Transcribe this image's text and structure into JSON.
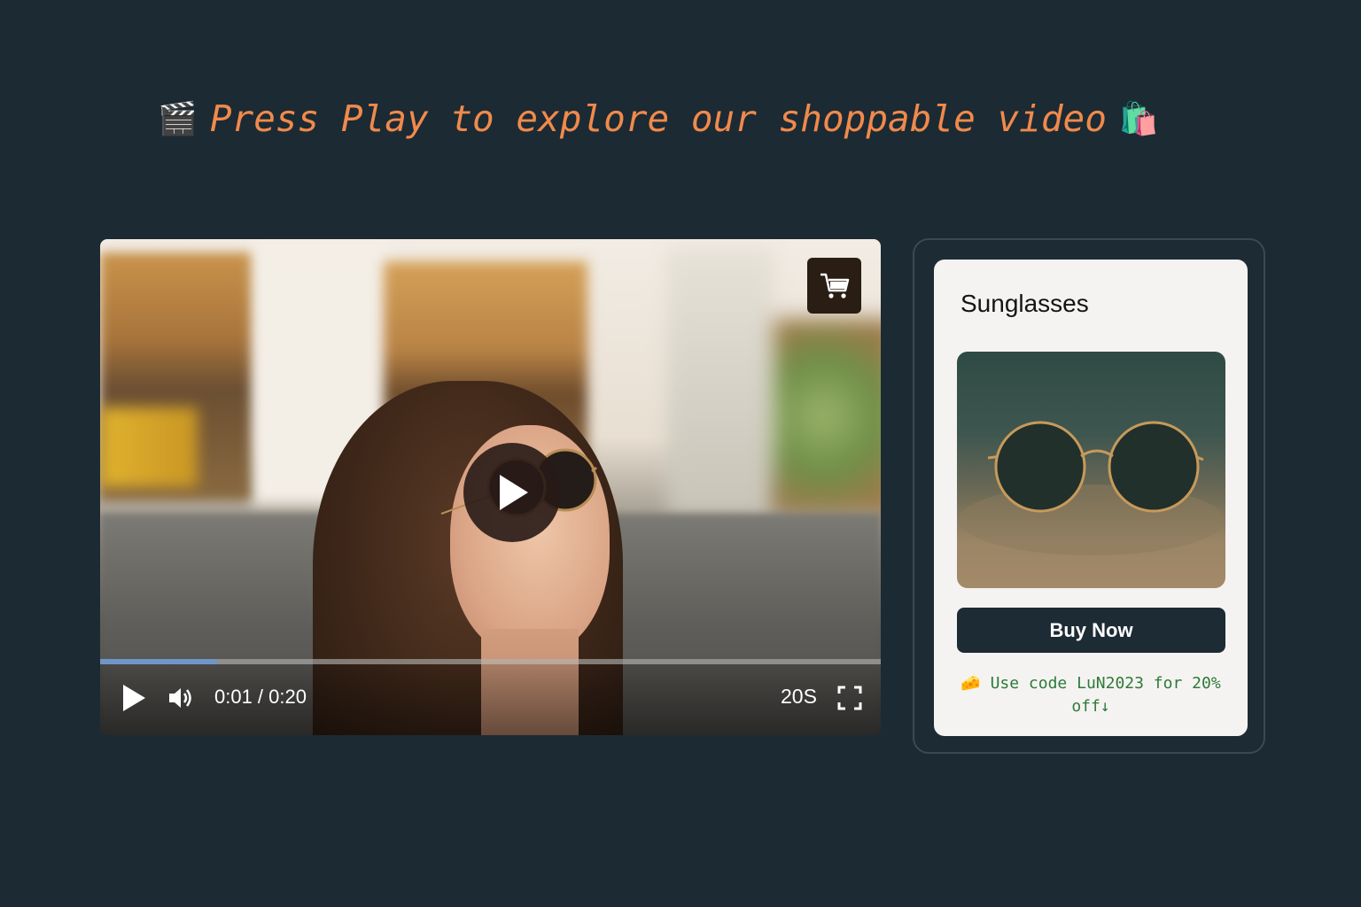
{
  "headline": {
    "icon_left": "🎬",
    "text": "Press Play to explore our shoppable video",
    "icon_right": "🛍️"
  },
  "video": {
    "big_play_icon": "play-icon",
    "shop_button_icon": "shopping-cart-icon",
    "controls": {
      "play_icon": "play-icon",
      "volume_icon": "volume-icon",
      "time": "0:01 / 0:20",
      "speed_label": "20S",
      "fullscreen_icon": "fullscreen-icon",
      "progress_fraction": 0.15
    }
  },
  "product": {
    "title": "Sunglasses",
    "buy_label": "Buy Now",
    "promo_icon": "🧀",
    "promo_text": "Use code LuN2023 for 20% off↓"
  },
  "colors": {
    "background": "#1c2a34",
    "headline": "#f08a4b",
    "progress": "#6f96c9",
    "button": "#1d2b35",
    "promo": "#2d7a3a"
  }
}
